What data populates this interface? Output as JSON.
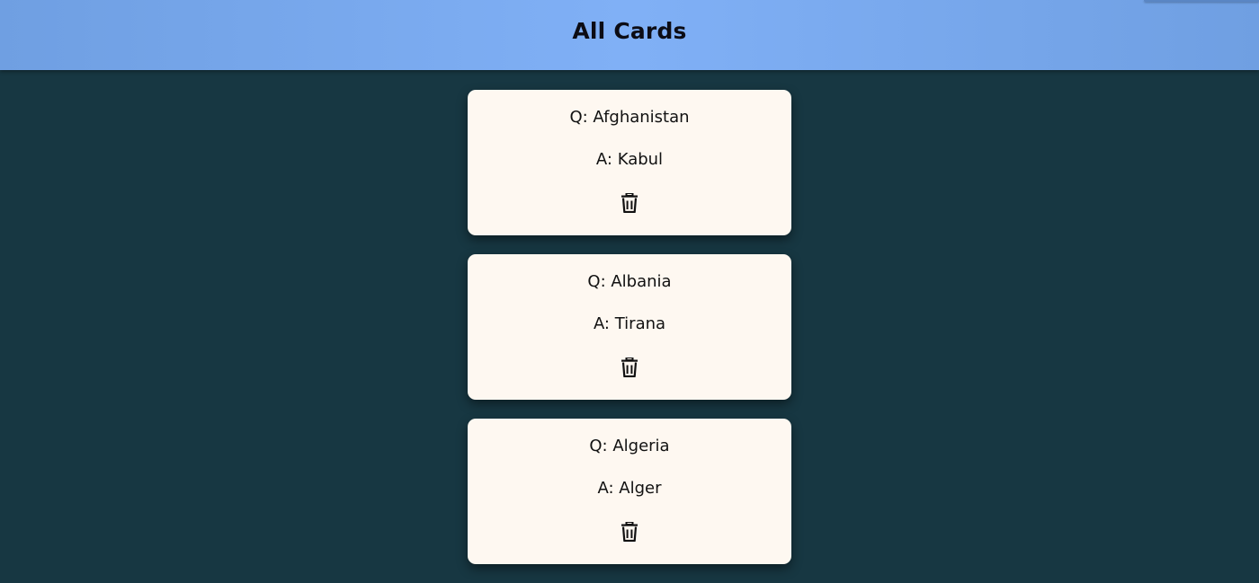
{
  "header": {
    "title": "All Cards"
  },
  "cards": [
    {
      "question": "Q: Afghanistan",
      "answer": "A: Kabul",
      "delete_icon": "trash-icon"
    },
    {
      "question": "Q: Albania",
      "answer": "A: Tirana",
      "delete_icon": "trash-icon"
    },
    {
      "question": "Q: Algeria",
      "answer": "A: Alger",
      "delete_icon": "trash-icon"
    }
  ],
  "colors": {
    "background": "#173742",
    "header": "#80b0f6",
    "card": "#fef8f1",
    "text": "#111111"
  }
}
